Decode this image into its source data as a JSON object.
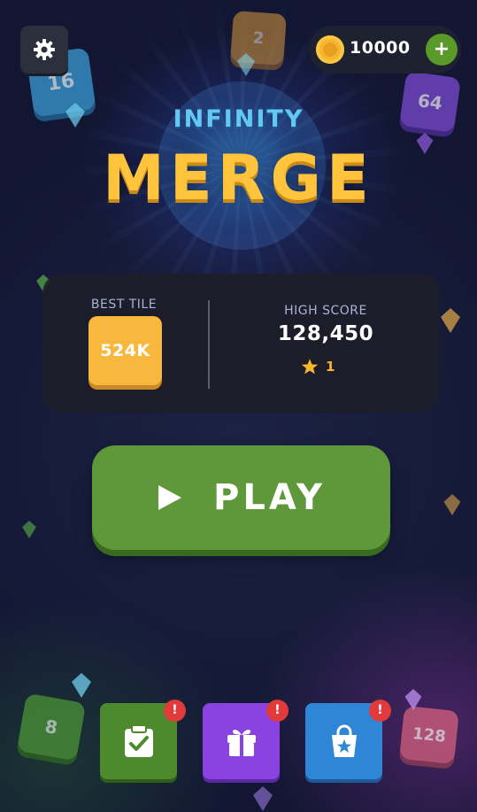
{
  "colors": {
    "background": "#161a34",
    "title_sub": "#63c9f4",
    "title_main": "#ffc43c",
    "best_tile": "#f8b83e",
    "play_button": "#5f983a",
    "coin": "#f6b52c",
    "badge": "#e03a3a"
  },
  "header": {
    "settings_icon": "gear-icon",
    "coins": {
      "icon": "coin-icon",
      "value": "10000",
      "add_label": "+"
    }
  },
  "title": {
    "subtitle": "INFINITY",
    "main": "MERGE"
  },
  "stats": {
    "best_tile_label": "BEST TILE",
    "best_tile_value": "524K",
    "high_score_label": "HIGH SCORE",
    "high_score_value": "128,450",
    "stars": "1",
    "star_icon": "star-icon"
  },
  "play": {
    "label": "PLAY",
    "icon": "play-icon"
  },
  "background_tiles": {
    "t16": "16",
    "t2": "2",
    "t64": "64",
    "t8": "8",
    "t128": "128"
  },
  "actions": [
    {
      "icon": "clipboard-check-icon",
      "badge": "!"
    },
    {
      "icon": "gift-icon",
      "badge": "!"
    },
    {
      "icon": "shopping-bag-icon",
      "badge": "!"
    }
  ]
}
